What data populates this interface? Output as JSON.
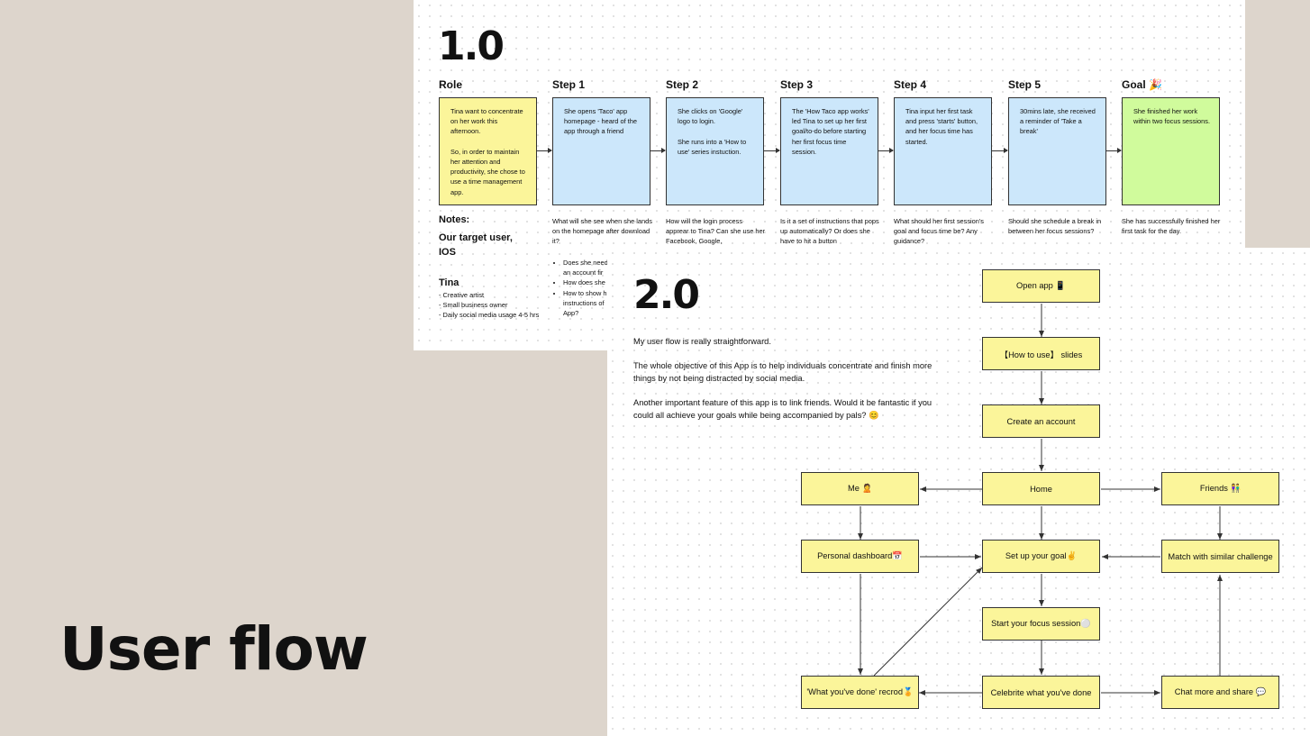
{
  "board1": {
    "heading": "1.0",
    "columns": [
      {
        "header": "Role",
        "note": "Tina want to concentrate on her work this afternoon.\n\nSo, in order to maintain her attention and productivity, she chose to use a time management app.",
        "question": "",
        "color": "yellow"
      },
      {
        "header": "Step 1",
        "note": "She opens 'Taco' app homepage - heard of the app through a friend",
        "question": "What will she see when she lands on the homepage after download it?",
        "color": "blue"
      },
      {
        "header": "Step 2",
        "note": "She clicks on 'Google' logo to login.\n\nShe runs into a 'How to use' series instuction.",
        "question": "How will the login process apprear to Tina? Can she use her Facebook, Google,",
        "color": "blue"
      },
      {
        "header": "Step 3",
        "note": "The 'How Taco app works' led Tina to set up her first goal/to-do before starting her first focus time session.",
        "question": "Is it a set of instructions that pops up automatically? Or does she have to hit a button",
        "color": "blue"
      },
      {
        "header": "Step 4",
        "note": "Tina input her first task and press 'starts' button, and her focus time has started.",
        "question": "What should her first session's goal and focus time be? Any guidance?",
        "color": "blue"
      },
      {
        "header": "Step 5",
        "note": "30mins late, she received a reminder of 'Take a break'",
        "question": "Should she schedule a break in between her focus sessions?",
        "color": "blue"
      },
      {
        "header": "Goal 🎉",
        "note": "She finished her work within two focus sessions.",
        "question": "She has successfully finished her first task for the day.",
        "color": "green"
      }
    ],
    "notes_label": "Notes:",
    "target_user": "Our target user, IOS",
    "persona_name": "Tina",
    "persona_traits": [
      "- Creative artist",
      "- Small business owner",
      "- Daily social media usage 4-5 hrs"
    ],
    "step1_bullets": [
      "Does she need",
      "an account fir",
      "How does she",
      "How to show h",
      "instructions of",
      "App?"
    ]
  },
  "board2": {
    "heading": "2.0",
    "paragraphs": [
      "My user flow is really straightforward.",
      "The whole objective of this App is to help individuals concentrate and finish more things by not being distracted by social media.",
      "Another important feature of this app is to link friends. Would it be fantastic if you could all achieve your goals while being accompanied by pals? 😊"
    ],
    "nodes": {
      "open_app": "Open app 📱",
      "how_to_use": "【How to use】 slides",
      "create_account": "Create an account",
      "me": "Me 🙎",
      "home": "Home",
      "friends": "Friends 👫",
      "personal_dashboard": "Personal dashboard📅",
      "set_goal": "Set up your goal✌",
      "match_challenge": "Match with similar challenge",
      "focus_session": "Start your focus session⚪",
      "done_record": "'What you've done' recrod🏅",
      "celebrate": "Celebrite what you've done",
      "chat_share": "Chat more and share 💬"
    }
  },
  "page_title": "User flow"
}
